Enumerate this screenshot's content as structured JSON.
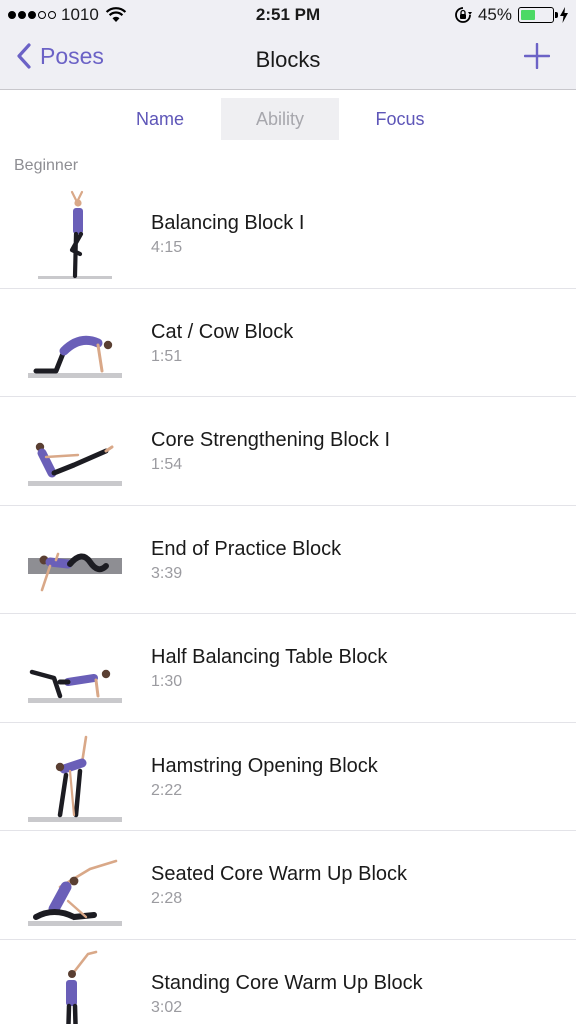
{
  "status_bar": {
    "carrier": "1010",
    "time": "2:51 PM",
    "battery_percent": "45%",
    "battery_level": 0.45,
    "signal_filled": 3,
    "signal_total": 5
  },
  "nav": {
    "back_label": "Poses",
    "title": "Blocks",
    "add_icon": "plus-icon"
  },
  "segments": {
    "items": [
      "Name",
      "Ability",
      "Focus"
    ],
    "selected": "Ability"
  },
  "section": {
    "header": "Beginner"
  },
  "blocks": [
    {
      "title": "Balancing Block I",
      "duration": "4:15",
      "pose": "tree-pose"
    },
    {
      "title": "Cat / Cow Block",
      "duration": "1:51",
      "pose": "cat-cow-pose"
    },
    {
      "title": "Core Strengthening Block I",
      "duration": "1:54",
      "pose": "boat-pose"
    },
    {
      "title": "End of Practice Block",
      "duration": "3:39",
      "pose": "supine-twist-pose"
    },
    {
      "title": "Half Balancing Table Block",
      "duration": "1:30",
      "pose": "balancing-table-pose"
    },
    {
      "title": "Hamstring Opening Block",
      "duration": "2:22",
      "pose": "revolved-forward-fold-pose"
    },
    {
      "title": "Seated Core Warm Up Block",
      "duration": "2:28",
      "pose": "seated-side-bend-pose"
    },
    {
      "title": "Standing Core Warm Up Block",
      "duration": "3:02",
      "pose": "standing-side-bend-pose"
    }
  ],
  "colors": {
    "accent": "#6b62c6",
    "bar_background": "#efeff4",
    "top_color": "#6a5fb8",
    "pants_color": "#1c1c22",
    "skin_color": "#d9a888",
    "mat_color": "#c9c9cc"
  }
}
